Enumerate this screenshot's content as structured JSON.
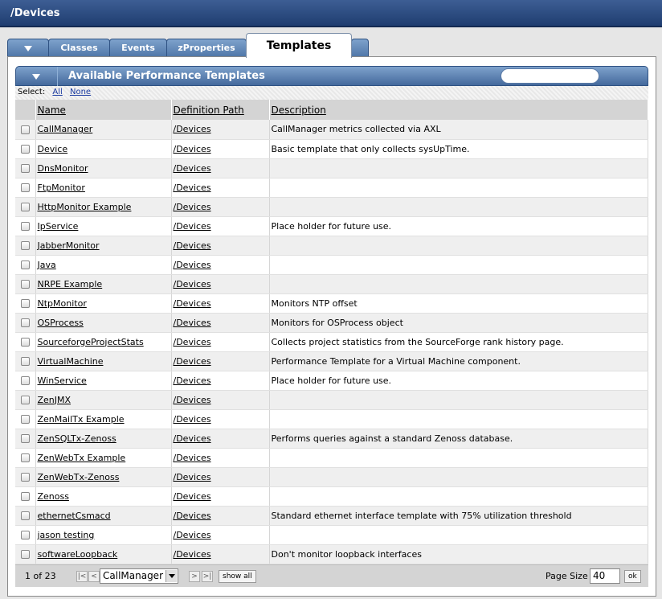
{
  "page": {
    "title": "/Devices"
  },
  "tabs": [
    {
      "label": ""
    },
    {
      "label": "Classes"
    },
    {
      "label": "Events"
    },
    {
      "label": "zProperties"
    },
    {
      "label": "Templates",
      "active": true
    }
  ],
  "section": {
    "title": "Available Performance Templates",
    "search_placeholder": ""
  },
  "select_bar": {
    "label": "Select:",
    "all": "All",
    "none": "None"
  },
  "table": {
    "columns": [
      "Name",
      "Definition Path",
      "Description"
    ],
    "rows": [
      {
        "name": "CallManager",
        "path": "/Devices",
        "description": "CallManager metrics collected via AXL"
      },
      {
        "name": "Device",
        "path": "/Devices",
        "description": "Basic template that only collects sysUpTime."
      },
      {
        "name": "DnsMonitor",
        "path": "/Devices",
        "description": ""
      },
      {
        "name": "FtpMonitor",
        "path": "/Devices",
        "description": ""
      },
      {
        "name": "HttpMonitor Example",
        "path": "/Devices",
        "description": ""
      },
      {
        "name": "IpService",
        "path": "/Devices",
        "description": "Place holder for future use."
      },
      {
        "name": "JabberMonitor",
        "path": "/Devices",
        "description": ""
      },
      {
        "name": "Java",
        "path": "/Devices",
        "description": ""
      },
      {
        "name": "NRPE Example",
        "path": "/Devices",
        "description": ""
      },
      {
        "name": "NtpMonitor",
        "path": "/Devices",
        "description": "Monitors NTP offset"
      },
      {
        "name": "OSProcess",
        "path": "/Devices",
        "description": "Monitors for OSProcess object"
      },
      {
        "name": "SourceforgeProjectStats",
        "path": "/Devices",
        "description": "Collects project statistics from the SourceForge rank history page."
      },
      {
        "name": "VirtualMachine",
        "path": "/Devices",
        "description": "Performance Template for a Virtual Machine component."
      },
      {
        "name": "WinService",
        "path": "/Devices",
        "description": "Place holder for future use."
      },
      {
        "name": "ZenJMX",
        "path": "/Devices",
        "description": ""
      },
      {
        "name": "ZenMailTx Example",
        "path": "/Devices",
        "description": ""
      },
      {
        "name": "ZenSQLTx-Zenoss",
        "path": "/Devices",
        "description": "Performs queries against a standard Zenoss database."
      },
      {
        "name": "ZenWebTx Example",
        "path": "/Devices",
        "description": ""
      },
      {
        "name": "ZenWebTx-Zenoss",
        "path": "/Devices",
        "description": ""
      },
      {
        "name": "Zenoss",
        "path": "/Devices",
        "description": ""
      },
      {
        "name": "ethernetCsmacd",
        "path": "/Devices",
        "description": "Standard ethernet interface template with 75% utilization threshold"
      },
      {
        "name": "jason testing",
        "path": "/Devices",
        "description": ""
      },
      {
        "name": "softwareLoopback",
        "path": "/Devices",
        "description": "Don't monitor loopback interfaces"
      }
    ]
  },
  "pager": {
    "info": "1 of 23",
    "first": "|<",
    "prev": "<",
    "next": ">",
    "last": ">|",
    "selected": "CallManager",
    "show_all": "show all",
    "page_size_label": "Page Size",
    "page_size": "40",
    "ok": "ok"
  }
}
